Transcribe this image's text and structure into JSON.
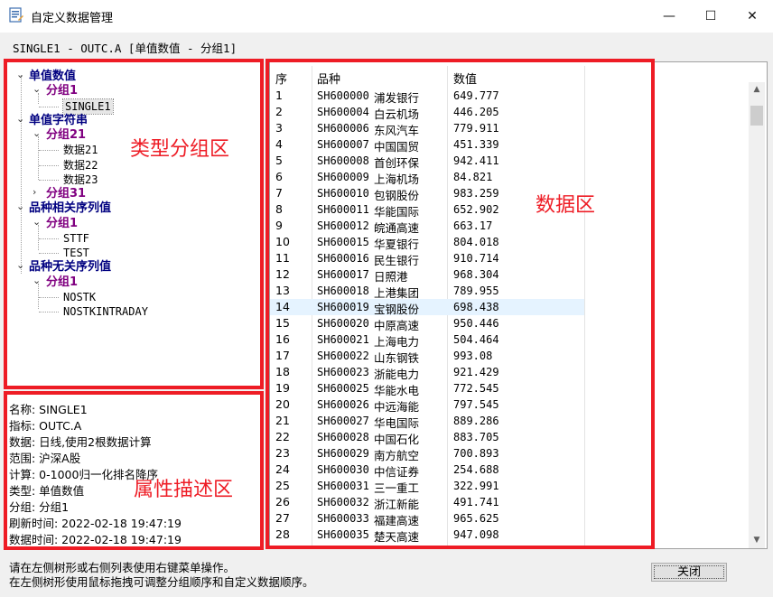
{
  "window": {
    "title": "自定义数据管理",
    "minimize_glyph": "—",
    "maximize_glyph": "☐",
    "close_glyph": "✕",
    "subheader": "SINGLE1 - OUTC.A [单值数值 - 分组1]"
  },
  "tree": {
    "nodes": [
      {
        "label": "单值数值",
        "kind": "category",
        "toggle": "⌄"
      },
      {
        "label": "分组1",
        "kind": "group",
        "toggle": "⌄"
      },
      {
        "label": "SINGLE1",
        "kind": "leaf",
        "selected": true
      },
      {
        "label": "单值字符串",
        "kind": "category",
        "toggle": "⌄"
      },
      {
        "label": "分组21",
        "kind": "group",
        "toggle": "⌄"
      },
      {
        "label": "数据21",
        "kind": "leaf"
      },
      {
        "label": "数据22",
        "kind": "leaf"
      },
      {
        "label": "数据23",
        "kind": "leaf"
      },
      {
        "label": "分组31",
        "kind": "group",
        "toggle": "›"
      },
      {
        "label": "品种相关序列值",
        "kind": "category",
        "toggle": "⌄"
      },
      {
        "label": "分组1",
        "kind": "group",
        "toggle": "⌄"
      },
      {
        "label": "STTF",
        "kind": "leaf"
      },
      {
        "label": "TEST",
        "kind": "leaf"
      },
      {
        "label": "品种无关序列值",
        "kind": "category",
        "toggle": "⌄"
      },
      {
        "label": "分组1",
        "kind": "group",
        "toggle": "⌄"
      },
      {
        "label": "NOSTK",
        "kind": "leaf"
      },
      {
        "label": "NOSTKINTRADAY",
        "kind": "leaf"
      }
    ]
  },
  "properties": {
    "lines": [
      "名称: SINGLE1",
      "指标: OUTC.A",
      "数据: 日线,使用2根数据计算",
      "范围: 沪深A股",
      "计算: 0-1000归一化排名降序",
      "类型: 单值数值",
      "分组: 分组1",
      "刷新时间: 2022-02-18 19:47:19",
      "数据时间: 2022-02-18 19:47:19"
    ]
  },
  "table": {
    "columns": [
      "序",
      "品种",
      "数值"
    ],
    "highlight_row": 14,
    "rows": [
      [
        "1",
        "SH600000",
        "浦发银行",
        "649.777"
      ],
      [
        "2",
        "SH600004",
        "白云机场",
        "446.205"
      ],
      [
        "3",
        "SH600006",
        "东风汽车",
        "779.911"
      ],
      [
        "4",
        "SH600007",
        "中国国贸",
        "451.339"
      ],
      [
        "5",
        "SH600008",
        "首创环保",
        "942.411"
      ],
      [
        "6",
        "SH600009",
        "上海机场",
        "84.821"
      ],
      [
        "7",
        "SH600010",
        "包钢股份",
        "983.259"
      ],
      [
        "8",
        "SH600011",
        "华能国际",
        "652.902"
      ],
      [
        "9",
        "SH600012",
        "皖通高速",
        "663.17"
      ],
      [
        "10",
        "SH600015",
        "华夏银行",
        "804.018"
      ],
      [
        "11",
        "SH600016",
        "民生银行",
        "910.714"
      ],
      [
        "12",
        "SH600017",
        "日照港",
        "968.304"
      ],
      [
        "13",
        "SH600018",
        "上港集团",
        "789.955"
      ],
      [
        "14",
        "SH600019",
        "宝钢股份",
        "698.438"
      ],
      [
        "15",
        "SH600020",
        "中原高速",
        "950.446"
      ],
      [
        "16",
        "SH600021",
        "上海电力",
        "504.464"
      ],
      [
        "17",
        "SH600022",
        "山东钢铁",
        "993.08"
      ],
      [
        "18",
        "SH600023",
        "浙能电力",
        "921.429"
      ],
      [
        "19",
        "SH600025",
        "华能水电",
        "772.545"
      ],
      [
        "20",
        "SH600026",
        "中远海能",
        "797.545"
      ],
      [
        "21",
        "SH600027",
        "华电国际",
        "889.286"
      ],
      [
        "22",
        "SH600028",
        "中国石化",
        "883.705"
      ],
      [
        "23",
        "SH600029",
        "南方航空",
        "700.893"
      ],
      [
        "24",
        "SH600030",
        "中信证券",
        "254.688"
      ],
      [
        "25",
        "SH600031",
        "三一重工",
        "322.991"
      ],
      [
        "26",
        "SH600032",
        "浙江新能",
        "491.741"
      ],
      [
        "27",
        "SH600033",
        "福建高速",
        "965.625"
      ],
      [
        "28",
        "SH600035",
        "楚天高速",
        "947.098"
      ]
    ]
  },
  "annotations": {
    "tree_label": "类型分组区",
    "data_label": "数据区",
    "prop_label": "属性描述区",
    "color": "#ee1c25"
  },
  "footer": {
    "line1": "请在左侧树形或右侧列表使用右键菜单操作。",
    "line2": "在左侧树形使用鼠标拖拽可调整分组顺序和自定义数据顺序。",
    "close_label": "关闭"
  }
}
